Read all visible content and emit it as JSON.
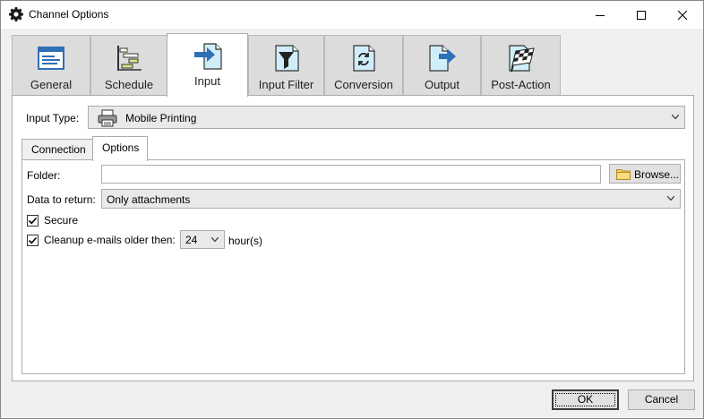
{
  "window": {
    "title": "Channel Options"
  },
  "tabs": [
    {
      "label": "General",
      "icon": "window-form-icon"
    },
    {
      "label": "Schedule",
      "icon": "gantt-schedule-icon"
    },
    {
      "label": "Input",
      "icon": "document-arrow-in-icon"
    },
    {
      "label": "Input Filter",
      "icon": "funnel-document-icon"
    },
    {
      "label": "Conversion",
      "icon": "refresh-document-icon"
    },
    {
      "label": "Output",
      "icon": "document-arrow-out-icon"
    },
    {
      "label": "Post-Action",
      "icon": "checkered-flag-icon"
    }
  ],
  "active_tab": "Input",
  "input_type": {
    "label": "Input Type:",
    "value": "Mobile Printing",
    "icon": "printer-icon"
  },
  "sub_tabs": [
    {
      "label": "Connection"
    },
    {
      "label": "Options"
    }
  ],
  "active_sub_tab": "Options",
  "options": {
    "folder_label": "Folder:",
    "folder_value": "",
    "browse_label": "Browse...",
    "data_label": "Data to return:",
    "data_value": "Only attachments",
    "secure_label": "Secure",
    "secure_checked": true,
    "cleanup_label": "Cleanup e-mails older then:",
    "cleanup_checked": true,
    "hours_value": "24",
    "hours_unit": "hour(s)"
  },
  "footer": {
    "ok_label": "OK",
    "cancel_label": "Cancel"
  },
  "colors": {
    "accent_blue": "#2f6fb6",
    "light_blue_doc": "#cfeefa",
    "active_tab_bg": "#ffffff",
    "inactive_tab_bg": "#dcdcdc"
  }
}
